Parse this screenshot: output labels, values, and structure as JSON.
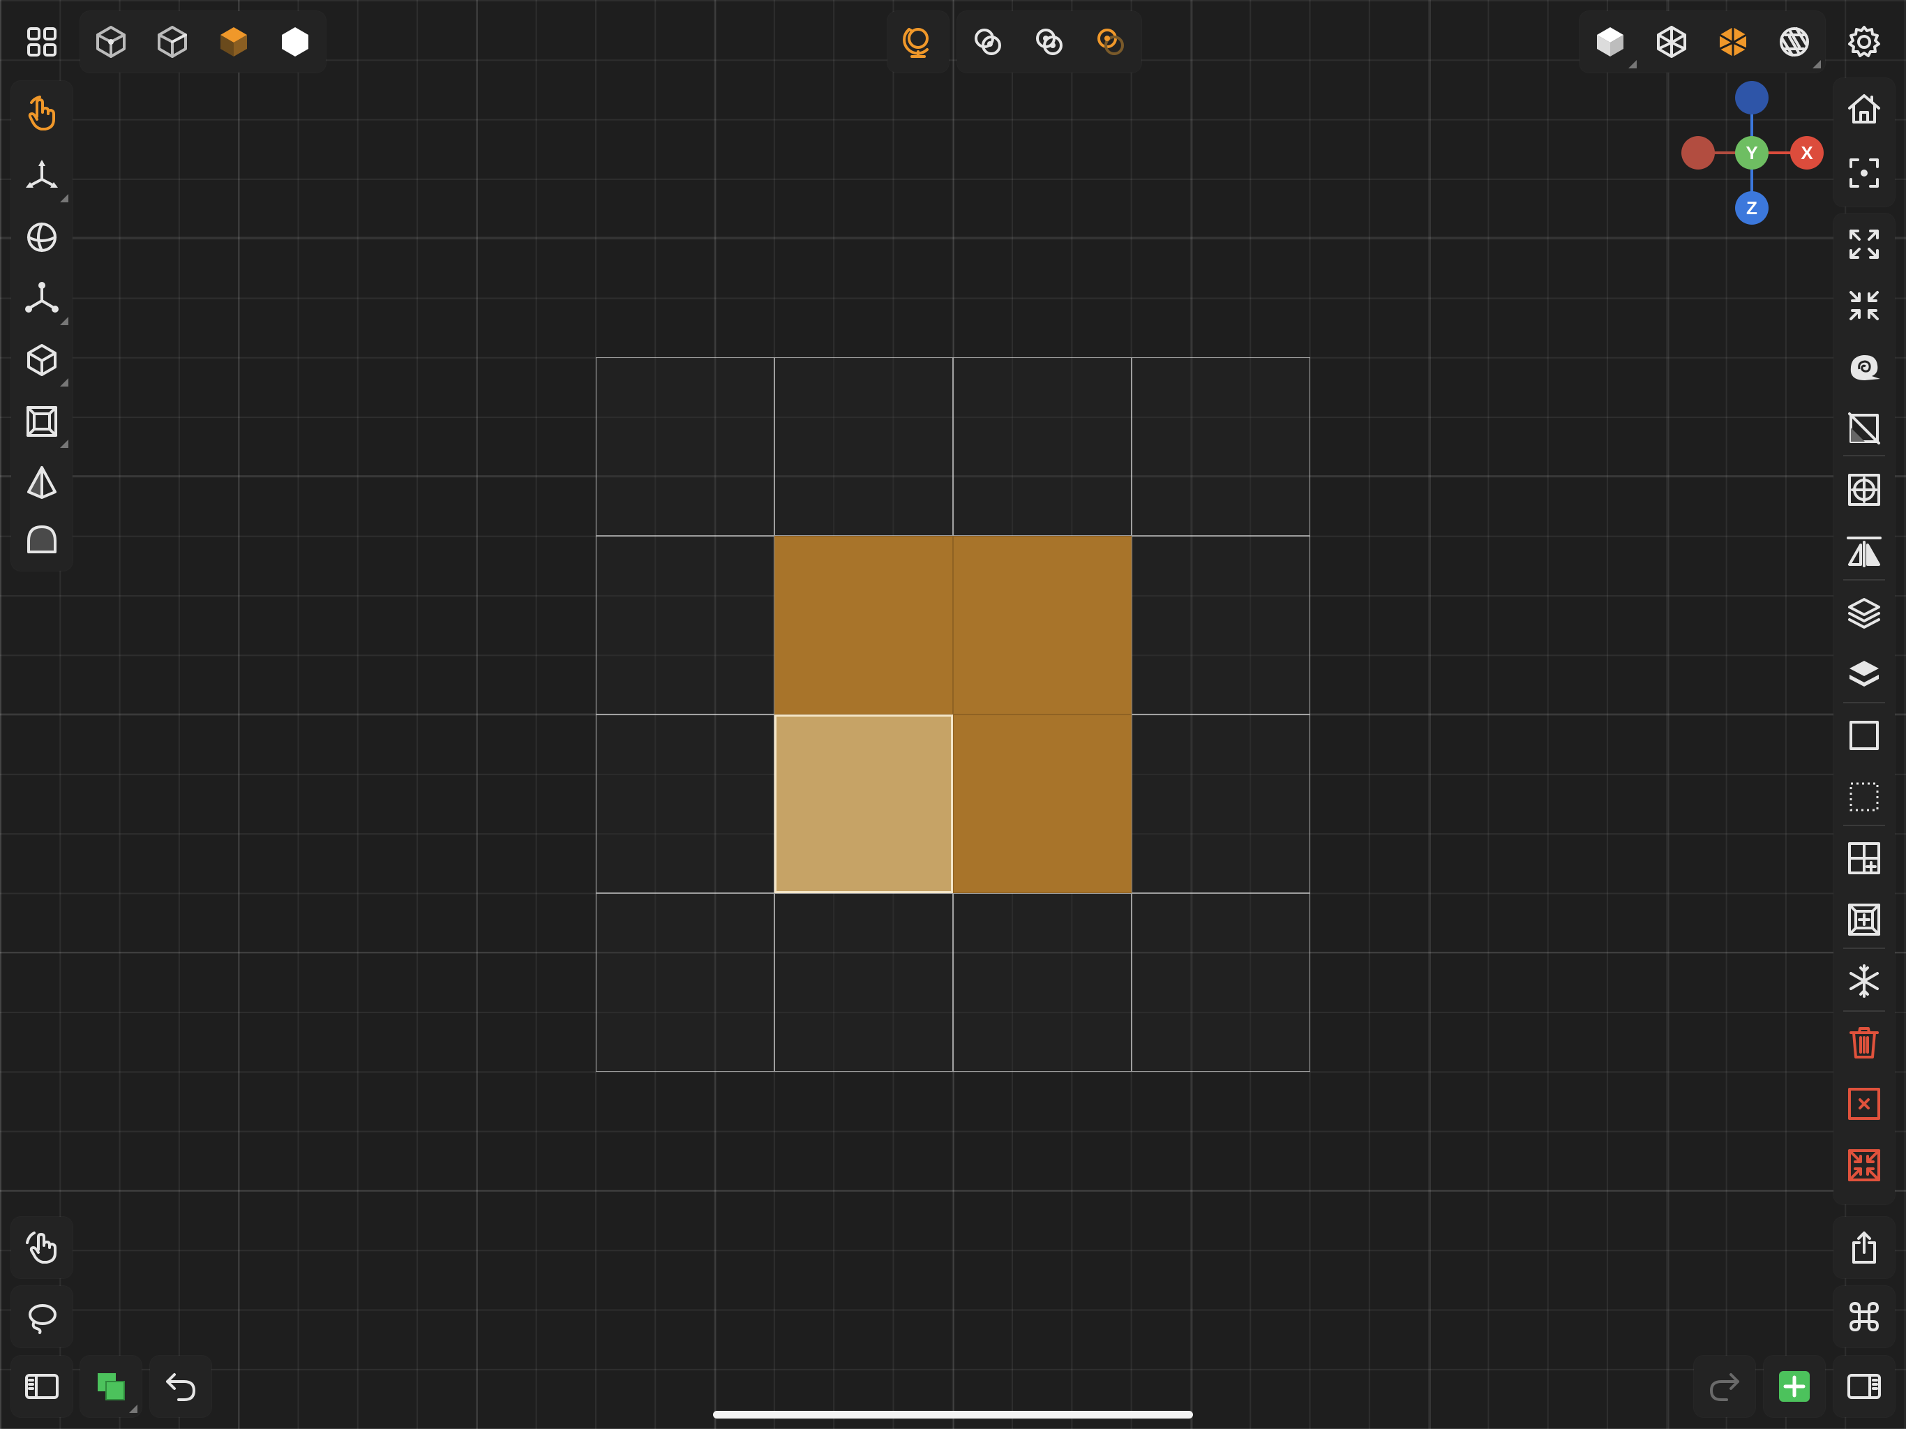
{
  "colors": {
    "background": "#1e1e1e",
    "accent_orange": "#f0982a",
    "block_dark": "#a8742a",
    "block_selected": "#c6a366",
    "axis_x": "#dc4c3c",
    "axis_y": "#6ebe62",
    "axis_z": "#3c78dc",
    "axis_neg_x": "#b24d40",
    "axis_neg_z": "#2e55a8",
    "add_green": "#4cc25c",
    "delete_red": "#e0523c"
  },
  "top_left": {
    "menu_icon": "grid-menu-icon",
    "view_modes": [
      {
        "icon": "vertex-cube-icon",
        "active": false
      },
      {
        "icon": "edge-cube-icon",
        "active": false
      },
      {
        "icon": "face-cube-icon",
        "active": true
      },
      {
        "icon": "solid-hex-icon",
        "active": false
      }
    ]
  },
  "top_center": {
    "snap": {
      "icon": "snap-globe-icon",
      "active": true
    },
    "selection_modes": [
      {
        "icon": "select-mode-1-icon",
        "active": false
      },
      {
        "icon": "select-mode-2-icon",
        "active": false
      },
      {
        "icon": "select-mode-3-icon",
        "active": true
      }
    ]
  },
  "top_right": {
    "display_modes": [
      {
        "icon": "solid-cube-icon",
        "active": false
      },
      {
        "icon": "wire-cube-icon",
        "active": false
      },
      {
        "icon": "xray-cube-icon",
        "active": true
      },
      {
        "icon": "shutter-icon",
        "active": false
      }
    ],
    "settings_icon": "settings-gear-icon"
  },
  "gizmo": {
    "x_label": "X",
    "y_label": "Y",
    "z_label": "Z"
  },
  "left_toolbar": [
    {
      "name": "hand-tool",
      "icon": "hand-pointer-icon",
      "active": true
    },
    {
      "name": "move-tool",
      "icon": "move-axes-icon",
      "active": false
    },
    {
      "name": "rotate-tool",
      "icon": "rotate-sphere-icon",
      "active": false
    },
    {
      "name": "scale-tool",
      "icon": "scale-axes-icon",
      "active": false
    },
    {
      "name": "cube-tool",
      "icon": "cube-icon",
      "active": false
    },
    {
      "name": "inset-tool",
      "icon": "inset-square-icon",
      "active": false
    },
    {
      "name": "pyramid-tool",
      "icon": "pyramid-icon",
      "active": false
    },
    {
      "name": "arch-tool",
      "icon": "arch-icon",
      "active": false
    }
  ],
  "right_toolbar": {
    "view": [
      "home-icon",
      "focus-icon"
    ],
    "tools": [
      "expand-icon",
      "collapse-icon",
      "spiral-shell-icon",
      "no-texture-icon",
      "crosshair-icon",
      "mirror-icon",
      "layers-outline-icon",
      "layers-filled-icon",
      "square-outline-icon",
      "dotted-square-icon",
      "subdivide-add-icon",
      "inset-add-icon",
      "snowflake-icon",
      "trash-icon",
      "delete-face-icon",
      "collapse-red-icon"
    ]
  },
  "bottom_left": {
    "gesture_icon": "touch-gesture-icon",
    "lasso_icon": "lasso-icon",
    "sidebar_icon": "sidebar-left-icon",
    "material_icon": "material-swatch-icon",
    "undo_icon": "undo-icon"
  },
  "bottom_right": {
    "share_icon": "share-icon",
    "command_icon": "command-icon",
    "redo_icon": "redo-icon",
    "add_icon": "add-plus-icon",
    "sidebar_icon": "sidebar-right-icon"
  },
  "canvas": {
    "rows": 4,
    "cols": 4,
    "filled_cells": [
      [
        1,
        1
      ],
      [
        1,
        2
      ],
      [
        2,
        2
      ]
    ],
    "selected_cells": [
      [
        2,
        1
      ]
    ]
  }
}
